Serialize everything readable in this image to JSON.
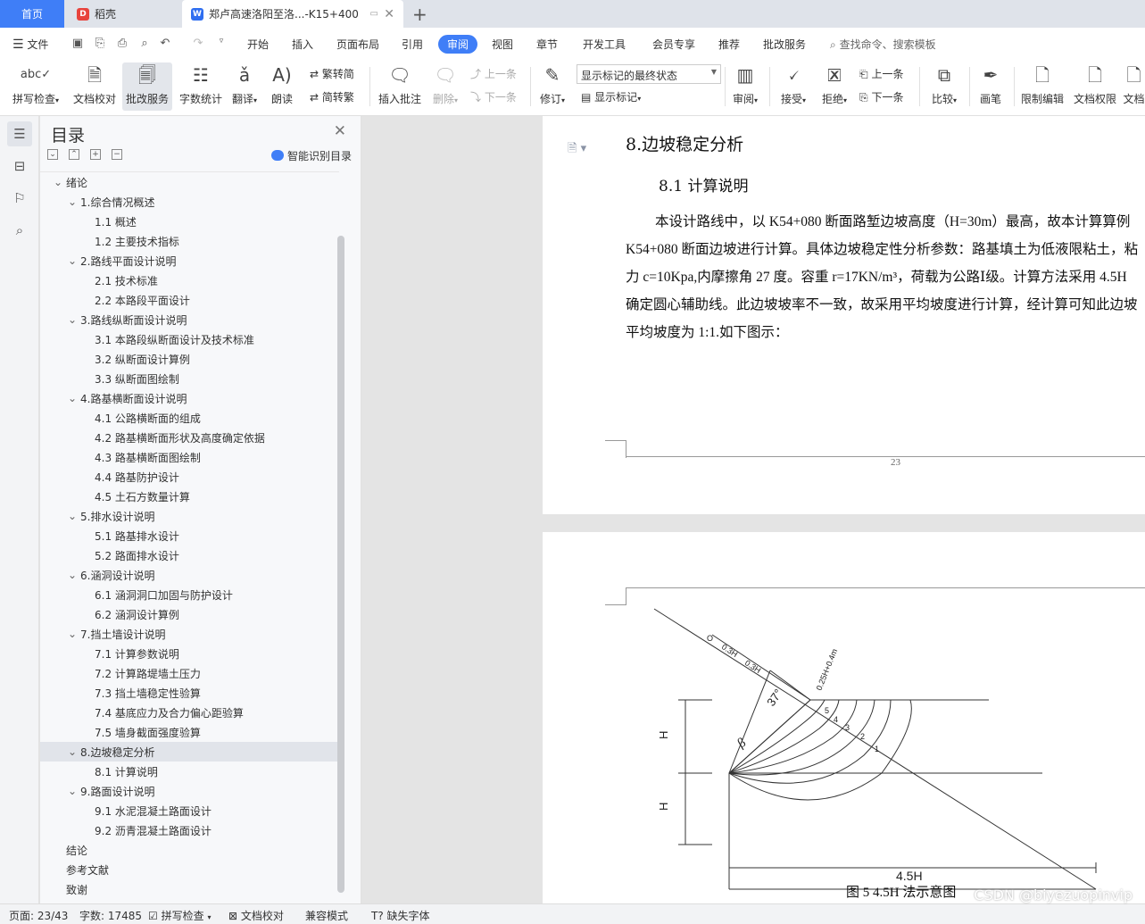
{
  "tabs": {
    "home": "首页",
    "daoke": "稻壳",
    "doc": "郑卢高速洛阳至洛...-K15+400"
  },
  "menu": {
    "file": "文件",
    "items": [
      "开始",
      "插入",
      "页面布局",
      "引用",
      "审阅",
      "视图",
      "章节",
      "开发工具",
      "会员专享",
      "推荐",
      "批改服务"
    ],
    "active": "审阅",
    "search": "查找命令、搜索模板"
  },
  "ribbon": {
    "spellcheck": "拼写检查",
    "doc_proof": "文档校对",
    "review_service": "批改服务",
    "word_count": "字数统计",
    "translate": "翻译",
    "read_aloud": "朗读",
    "trad_to_simp": "繁转简",
    "simp_to_trad": "简转繁",
    "insert_comment": "插入批注",
    "delete": "删除",
    "prev_comment": "上一条",
    "next_comment": "下一条",
    "revise": "修订",
    "markup_state": "显示标记的最终状态",
    "show_markup": "显示标记",
    "review": "审阅",
    "accept": "接受",
    "reject": "拒绝",
    "prev_change": "上一条",
    "next_change": "下一条",
    "compare": "比较",
    "pen": "画笔",
    "restrict_edit": "限制编辑",
    "doc_permission": "文档权限",
    "doc_more": "文档"
  },
  "toc": {
    "title": "目录",
    "smart": "智能识别目录",
    "items": [
      {
        "text": "绪论",
        "level": 0,
        "caret": true
      },
      {
        "text": "1.综合情况概述",
        "level": 1,
        "caret": true
      },
      {
        "text": "1.1 概述",
        "level": 2,
        "caret": false
      },
      {
        "text": "1.2  主要技术指标",
        "level": 2,
        "caret": false
      },
      {
        "text": "2.路线平面设计说明",
        "level": 1,
        "caret": true
      },
      {
        "text": "2.1  技术标准",
        "level": 2,
        "caret": false
      },
      {
        "text": "2.2  本路段平面设计",
        "level": 2,
        "caret": false
      },
      {
        "text": "3.路线纵断面设计说明",
        "level": 1,
        "caret": true
      },
      {
        "text": "3.1  本路段纵断面设计及技术标准",
        "level": 2,
        "caret": false
      },
      {
        "text": "3.2  纵断面设计算例",
        "level": 2,
        "caret": false
      },
      {
        "text": "3.3  纵断面图绘制",
        "level": 2,
        "caret": false
      },
      {
        "text": "4.路基横断面设计说明",
        "level": 1,
        "caret": true
      },
      {
        "text": "4.1  公路横断面的组成",
        "level": 2,
        "caret": false
      },
      {
        "text": "4.2  路基横断面形状及高度确定依据",
        "level": 2,
        "caret": false
      },
      {
        "text": "4.3  路基横断面图绘制",
        "level": 2,
        "caret": false
      },
      {
        "text": "4.4  路基防护设计",
        "level": 2,
        "caret": false
      },
      {
        "text": "4.5  土石方数量计算",
        "level": 2,
        "caret": false
      },
      {
        "text": "5.排水设计说明",
        "level": 1,
        "caret": true
      },
      {
        "text": "5.1  路基排水设计",
        "level": 2,
        "caret": false
      },
      {
        "text": "5.2  路面排水设计",
        "level": 2,
        "caret": false
      },
      {
        "text": "6.涵洞设计说明",
        "level": 1,
        "caret": true
      },
      {
        "text": "6.1  涵洞洞口加固与防护设计",
        "level": 2,
        "caret": false
      },
      {
        "text": "6.2  涵洞设计算例",
        "level": 2,
        "caret": false
      },
      {
        "text": "7.挡土墙设计说明",
        "level": 1,
        "caret": true
      },
      {
        "text": "7.1  计算参数说明",
        "level": 2,
        "caret": false
      },
      {
        "text": "7.2  计算路堤墙土压力",
        "level": 2,
        "caret": false
      },
      {
        "text": "7.3  挡土墙稳定性验算",
        "level": 2,
        "caret": false
      },
      {
        "text": "7.4  基底应力及合力偏心距验算",
        "level": 2,
        "caret": false
      },
      {
        "text": "7.5  墙身截面强度验算",
        "level": 2,
        "caret": false
      },
      {
        "text": "8.边坡稳定分析",
        "level": 1,
        "caret": true,
        "selected": true
      },
      {
        "text": "8.1 计算说明",
        "level": 2,
        "caret": false
      },
      {
        "text": "9.路面设计说明",
        "level": 1,
        "caret": true
      },
      {
        "text": "9.1  水泥混凝土路面设计",
        "level": 2,
        "caret": false
      },
      {
        "text": "9.2  沥青混凝土路面设计",
        "level": 2,
        "caret": false
      },
      {
        "text": "结论",
        "level": 0,
        "caret": false
      },
      {
        "text": "参考文献",
        "level": 0,
        "caret": false
      },
      {
        "text": "致谢",
        "level": 0,
        "caret": false
      }
    ]
  },
  "document": {
    "heading": "8.边坡稳定分析",
    "subheading": "8.1 计算说明",
    "lines": [
      "本设计路线中，以 K54+080 断面路堑边坡高度（H=30m）最高，故本计算算例",
      "K54+080 断面边坡进行计算。具体边坡稳定性分析参数：路基填土为低液限粘土，粘",
      "力 c=10Kpa,内摩擦角 27 度。容重 r=17KN/m³，荷载为公路Ⅰ级。计算方法采用 4.5H",
      "确定圆心辅助线。此边坡坡率不一致，故采用平均坡度进行计算，经计算可知此边坡",
      "平均坡度为 1:1.如下图示："
    ],
    "page_number": "23",
    "figure": {
      "caption": "图 5    4.5H 法示意图",
      "label_h": "H",
      "label_45h": "4.5H",
      "label_angle": "37°",
      "label_beta": "β",
      "label_03h": "0.3H",
      "label_025h": "0.25H+0.4m",
      "label_o": "O",
      "arc_labels": [
        "1",
        "2",
        "3",
        "4",
        "5"
      ]
    }
  },
  "status": {
    "page": "页面: 23/43",
    "words": "字数: 17485",
    "spellcheck": "拼写检查",
    "proof": "文档校对",
    "compat": "兼容模式",
    "missing_font": "缺失字体"
  },
  "watermark": "CSDN @biyezuopinvip"
}
